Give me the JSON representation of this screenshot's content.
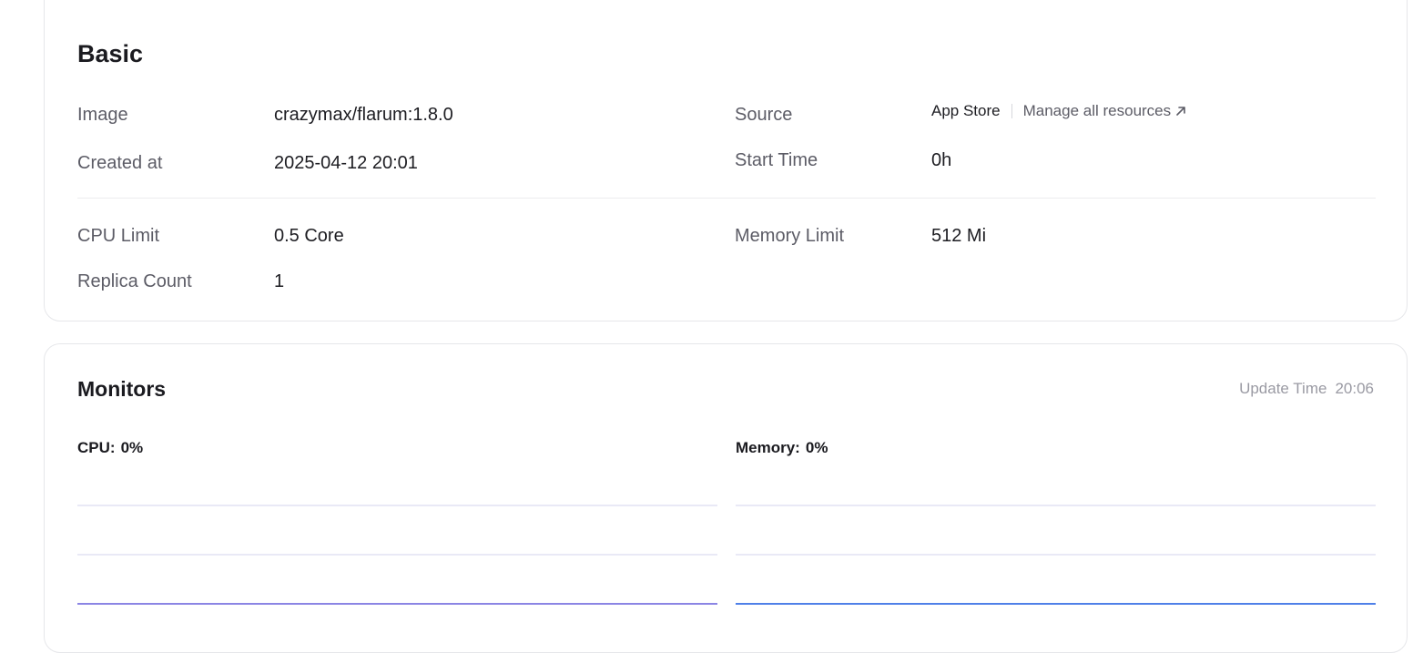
{
  "basic": {
    "title": "Basic",
    "image_label": "Image",
    "image_value": "crazymax/flarum:1.8.0",
    "created_label": "Created at",
    "created_value": "2025-04-12 20:01",
    "source_label": "Source",
    "source_value": "App Store",
    "manage_link": "Manage all resources",
    "start_label": "Start Time",
    "start_value": "0h",
    "cpu_limit_label": "CPU Limit",
    "cpu_limit_value": "0.5 Core",
    "memory_limit_label": "Memory Limit",
    "memory_limit_value": "512 Mi",
    "replica_label": "Replica Count",
    "replica_value": "1"
  },
  "monitors": {
    "title": "Monitors",
    "update_label": "Update Time",
    "update_value": "20:06",
    "cpu_label": "CPU:",
    "cpu_value": "0%",
    "memory_label": "Memory:",
    "memory_value": "0%",
    "icons": {
      "manage_link": "arrow-up-right-icon"
    },
    "colors": {
      "cpu_line": "#8b85e4",
      "memory_line": "#4f80e8",
      "grid_line": "#e2e2f4"
    }
  },
  "chart_data": [
    {
      "type": "line",
      "series": [
        {
          "values": [
            0,
            0
          ]
        }
      ],
      "ylim": [
        0,
        2
      ],
      "grid": true,
      "xlabel": "",
      "ylabel": ""
    },
    {
      "type": "line",
      "series": [
        {
          "values": [
            0,
            0
          ]
        }
      ],
      "ylim": [
        0,
        2
      ],
      "grid": true,
      "xlabel": "",
      "ylabel": ""
    }
  ]
}
